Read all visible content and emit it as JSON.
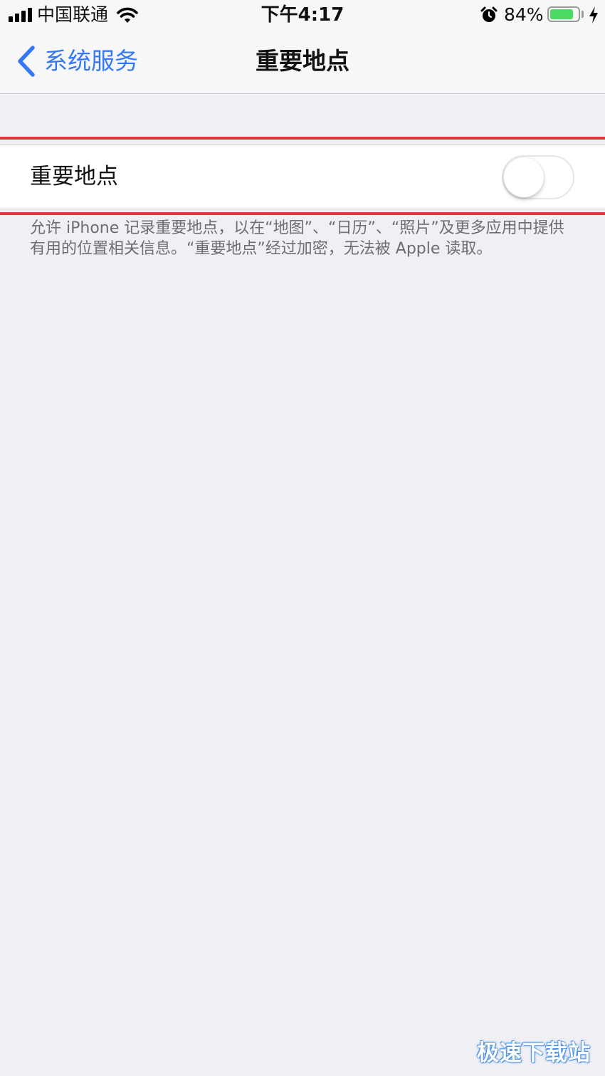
{
  "status_bar": {
    "carrier": "中国联通",
    "time": "下午4:17",
    "battery_percent": "84%",
    "battery_level": 0.84,
    "icons": [
      "signal-icon",
      "wifi-icon",
      "alarm-icon",
      "battery-icon",
      "charging-icon"
    ]
  },
  "nav": {
    "back_label": "系统服务",
    "title": "重要地点"
  },
  "settings": {
    "significant_locations": {
      "label": "重要地点",
      "enabled": false
    },
    "footer": "允许 iPhone 记录重要地点，以在“地图”、“日历”、“照片”及更多应用中提供有用的位置相关信息。“重要地点”经过加密，无法被 Apple 读取。"
  },
  "watermark": "极速下载站",
  "colors": {
    "accent": "#3478f6",
    "highlight_line": "#e0343f",
    "background": "#efeff4",
    "battery": "#4cd964"
  }
}
